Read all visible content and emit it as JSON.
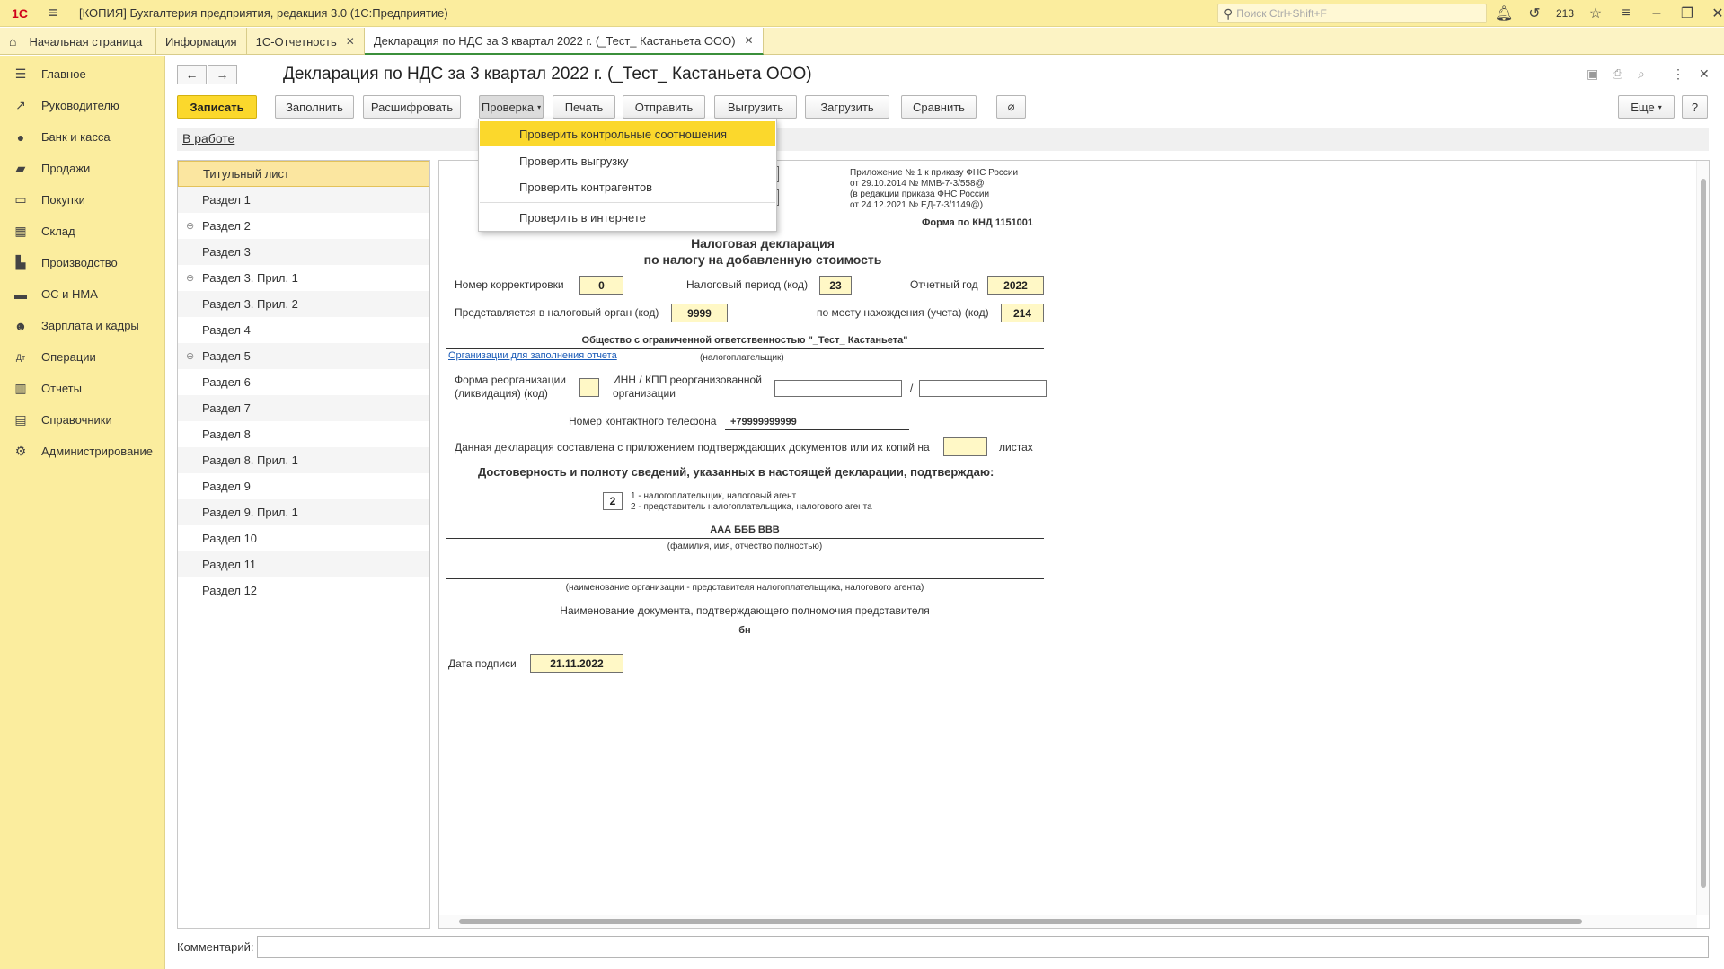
{
  "app": {
    "logo": "1С",
    "title": "[КОПИЯ] Бухгалтерия предприятия, редакция 3.0  (1С:Предприятие)",
    "search_placeholder": "Поиск Ctrl+Shift+F",
    "notification_count": "213"
  },
  "tabs": [
    {
      "label": "Начальная страница"
    },
    {
      "label": "Информация"
    },
    {
      "label": "1С-Отчетность"
    },
    {
      "label": "Декларация по НДС за 3 квартал 2022 г. (_Тест_ Кастаньета ООО)"
    }
  ],
  "sidebar": {
    "items": [
      {
        "label": "Главное",
        "icon": "menu-icon"
      },
      {
        "label": "Руководителю",
        "icon": "chart-trend-icon"
      },
      {
        "label": "Банк и касса",
        "icon": "coin-icon"
      },
      {
        "label": "Продажи",
        "icon": "bag-icon"
      },
      {
        "label": "Покупки",
        "icon": "cart-icon"
      },
      {
        "label": "Склад",
        "icon": "warehouse-icon"
      },
      {
        "label": "Производство",
        "icon": "factory-icon"
      },
      {
        "label": "ОС и НМА",
        "icon": "truck-icon"
      },
      {
        "label": "Зарплата и кадры",
        "icon": "person-icon"
      },
      {
        "label": "Операции",
        "icon": "dt-kt-icon"
      },
      {
        "label": "Отчеты",
        "icon": "bar-chart-icon"
      },
      {
        "label": "Справочники",
        "icon": "book-icon"
      },
      {
        "label": "Администрирование",
        "icon": "gear-icon"
      }
    ]
  },
  "document": {
    "title": "Декларация по НДС за 3 квартал 2022 г. (_Тест_ Кастаньета ООО)",
    "status": "В работе"
  },
  "toolbar": {
    "save": "Записать",
    "fill": "Заполнить",
    "decode": "Расшифровать",
    "check": "Проверка",
    "print": "Печать",
    "send": "Отправить",
    "upload": "Выгрузить",
    "load": "Загрузить",
    "compare": "Сравнить",
    "more": "Еще",
    "help": "?"
  },
  "check_menu": {
    "items": [
      "Проверить контрольные соотношения",
      "Проверить выгрузку",
      "Проверить контрагентов",
      "Проверить в интернете"
    ],
    "highlighted": "Проверить контрольные соотношения"
  },
  "sections": [
    "Титульный лист",
    "Раздел 1",
    "Раздел 2",
    "Раздел 3",
    "Раздел 3. Прил. 1",
    "Раздел 3. Прил. 2",
    "Раздел 4",
    "Раздел 5",
    "Раздел 6",
    "Раздел 7",
    "Раздел 8",
    "Раздел 8. Прил. 1",
    "Раздел 9",
    "Раздел 9. Прил. 1",
    "Раздел 10",
    "Раздел 11",
    "Раздел 12"
  ],
  "form": {
    "appendix_lines": [
      "Приложение № 1 к приказу ФНС России",
      "от 29.10.2014 № ММВ-7-3/558@",
      "(в редакции приказа ФНС России",
      "от 24.12.2021 № ЕД-7-3/1149@)"
    ],
    "knd": "Форма по КНД 1151001",
    "heading1": "Налоговая декларация",
    "heading2": "по налогу на добавленную стоимость",
    "correction_label": "Номер корректировки",
    "correction_value": "0",
    "period_label": "Налоговый период (код)",
    "period_value": "23",
    "year_label": "Отчетный год",
    "year_value": "2022",
    "authority_label": "Представляется в налоговый орган (код)",
    "authority_value": "9999",
    "location_label": "по месту нахождения (учета) (код)",
    "location_value": "214",
    "org_name": "Общество с ограниченной ответственностью \"_Тест_ Кастаньета\"",
    "org_link": "Организации для заполнения отчета",
    "taxpayer_caption": "(налогоплательщик)",
    "reorg_label1": "Форма реорганизации",
    "reorg_label2": "(ликвидация) (код)",
    "inn_label1": "ИНН / КПП реорганизованной",
    "inn_label2": "организации",
    "slash": "/",
    "phone_label": "Номер контактного телефона",
    "phone_value": "+79999999999",
    "pages_label": "Данная декларация составлена с приложением подтверждающих документов или их копий на",
    "pages_suffix": "листах",
    "confirm_heading": "Достоверность и полноту сведений, указанных в настоящей декларации, подтверждаю:",
    "signer_code": "2",
    "signer_opt1": "1 - налогоплательщик, налоговый агент",
    "signer_opt2": "2 - представитель налогоплательщика, налогового агента",
    "fio_value": "ААА БББ ВВВ",
    "fio_caption": "(фамилия, имя, отчество полностью)",
    "rep_org_caption": "(наименование организации - представителя налогоплательщика, налогового агента)",
    "doc_label": "Наименование документа, подтверждающего полномочия представителя",
    "doc_value": "бн",
    "sign_date_label": "Дата подписи",
    "sign_date_value": "21.11.2022"
  },
  "comment_label": "Комментарий:",
  "colors": {
    "accent": "#fbd82c",
    "panel": "#fbed9e",
    "field": "#fff8c6"
  }
}
